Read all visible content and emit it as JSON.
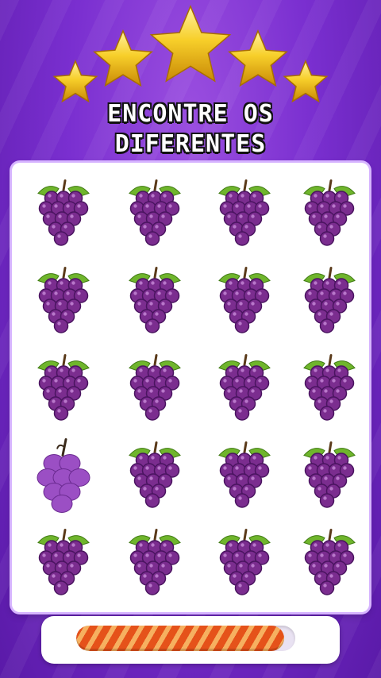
{
  "title": {
    "line1": "ENCONTRE OS",
    "line2": "DIFERENTES"
  },
  "stars": {
    "count": 5,
    "color": "#f2c21a"
  },
  "grid": {
    "rows": 5,
    "cols": 4,
    "item_icon": "grape-bunch-icon",
    "odd_item_icon": "plain-grape-bunch-icon",
    "odd_position": {
      "row": 4,
      "col": 1
    },
    "grape_color": "#7b2d8f",
    "odd_grape_color": "#9b4fc4",
    "leaf_color": "#6fb52c"
  },
  "timer": {
    "progress": 0.95,
    "colors": [
      "#e5521a",
      "#f6b060"
    ]
  }
}
